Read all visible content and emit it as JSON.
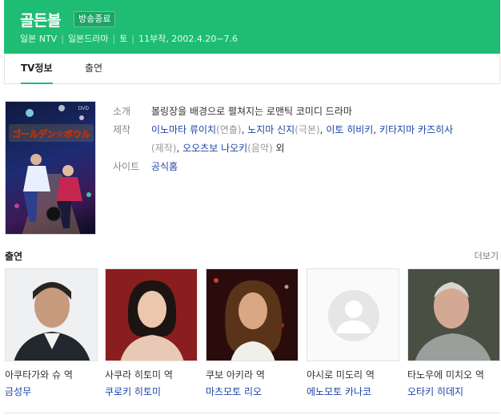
{
  "header": {
    "title": "골든볼",
    "badge": "방송종료",
    "meta": [
      "일본 NTV",
      "일본드라마",
      "토",
      "11부작, 2002.4.20~7.6"
    ]
  },
  "tabs": [
    {
      "label": "TV정보",
      "active": true
    },
    {
      "label": "출연",
      "active": false
    }
  ],
  "poster": {
    "title_text": "ゴールデン☆ボウル",
    "brand": "DVD"
  },
  "info": {
    "intro_label": "소개",
    "intro_value": "볼링장을 배경으로 펼쳐지는 로맨틱 코미디 드라마",
    "production_label": "제작",
    "production": {
      "p1": "이노마타 류이치",
      "p1_role": "(연출)",
      "p2": "노지마 신지",
      "p2_role": "(극본)",
      "p3": "이토 히비키",
      "p4": "키타지마 카즈히사",
      "p4_role": "(제작)",
      "p5": "오오츠보 나오키",
      "p5_role": "(음악)",
      "etc": "외"
    },
    "site_label": "사이트",
    "site_value": "공식홈"
  },
  "cast_section": {
    "title": "출연",
    "more": "더보기",
    "members": [
      {
        "role": "아쿠타가와 슈 역",
        "name": "금성무"
      },
      {
        "role": "사쿠라 히토미 역",
        "name": "쿠로키 히토미"
      },
      {
        "role": "쿠보 아키라 역",
        "name": "마츠모토 리오"
      },
      {
        "role": "야시로 미도리 역",
        "name": "에노모토 카나코"
      },
      {
        "role": "타노우에 미치오 역",
        "name": "오타키 히데지"
      }
    ]
  },
  "colors": {
    "brand_green": "#1ebd73",
    "link_blue": "#1d44a8"
  }
}
